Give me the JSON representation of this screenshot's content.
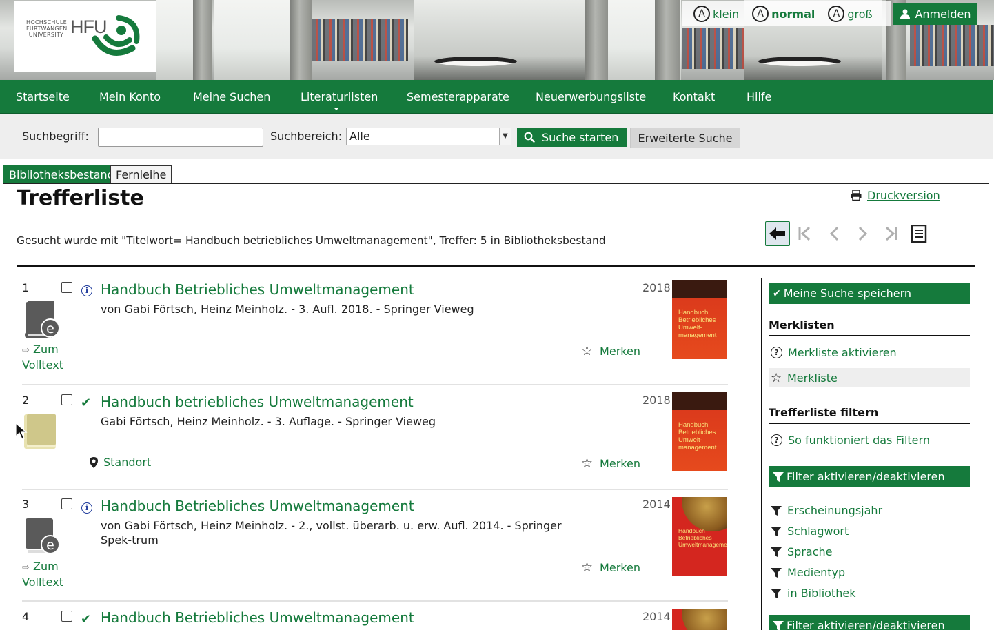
{
  "header": {
    "logo": {
      "small_text": [
        "HOCHSCHULE",
        "FURTWANGEN",
        "UNIVERSITY"
      ],
      "brand": "HFU"
    },
    "accessibility": [
      {
        "label": "klein",
        "bold": false
      },
      {
        "label": "normal",
        "bold": true
      },
      {
        "label": "groß",
        "bold": false
      }
    ],
    "login_label": "Anmelden"
  },
  "nav": {
    "items": [
      "Startseite",
      "Mein Konto",
      "Meine Suchen",
      "Literaturlisten",
      "Semesterapparate",
      "Neuerwerbungsliste",
      "Kontakt",
      "Hilfe"
    ]
  },
  "search": {
    "term_label": "Suchbegriff:",
    "term_value": "",
    "area_label": "Suchbereich:",
    "area_value": "Alle",
    "search_button": "Suche starten",
    "advanced_button": "Erweiterte Suche"
  },
  "tabs": {
    "active": "Bibliotheksbestand",
    "inactive": "Fernleihe"
  },
  "page": {
    "title": "Trefferliste",
    "print_link": "Druckversion",
    "query_text": "Gesucht wurde mit \"Titelwort= Handbuch betriebliches Umweltmanagement\", Treffer: 5 in Bibliotheksbestand"
  },
  "results": [
    {
      "num": "1",
      "title": "Handbuch Betriebliches Umweltmanagement",
      "subtitle": "von Gabi Förtsch, Heinz Meinholz. - 3. Aufl. 2018. - Springer Vieweg",
      "year": "2018",
      "merken": "Merken",
      "volltext": [
        "Zum",
        "Volltext"
      ],
      "cover_title": [
        "Handbuch",
        "Betriebliches",
        "Umwelt-",
        "management"
      ]
    },
    {
      "num": "2",
      "title": "Handbuch betriebliches Umweltmanagement",
      "subtitle": "Gabi Förtsch, Heinz Meinholz. - 3. Auflage. - Springer Vieweg",
      "year": "2018",
      "merken": "Merken",
      "standort": "Standort",
      "cover_title": [
        "Handbuch",
        "Betriebliches",
        "Umwelt-",
        "management"
      ]
    },
    {
      "num": "3",
      "title": "Handbuch Betriebliches Umweltmanagement",
      "subtitle": "von Gabi Förtsch, Heinz Meinholz. - 2., vollst. überarb. u. erw. Aufl. 2014. - Springer Spek-trum",
      "year": "2014",
      "merken": "Merken",
      "volltext": [
        "Zum",
        "Volltext"
      ],
      "cover_title": [
        "Handbuch",
        "Betriebliches",
        "Umweltmanagement"
      ]
    },
    {
      "num": "4",
      "title": "Handbuch Betriebliches Umweltmanagement",
      "year": "2014"
    }
  ],
  "sidebar": {
    "save_search": "Meine Suche speichern",
    "merklisten_heading": "Merklisten",
    "merkliste_activate": "Merkliste aktivieren",
    "merkliste": "Merkliste",
    "filter_heading": "Trefferliste filtern",
    "filter_howto": "So funktioniert das Filtern",
    "filter_toggle": "Filter aktivieren/deaktivieren",
    "filters": [
      "Erscheinungsjahr",
      "Schlagwort",
      "Sprache",
      "Medientyp",
      "in Bibliothek"
    ],
    "filter_toggle_bottom": "Filter aktivieren/deaktivieren"
  },
  "colors": {
    "accent": "#157a3c",
    "link_blue": "#1f3b9c"
  }
}
